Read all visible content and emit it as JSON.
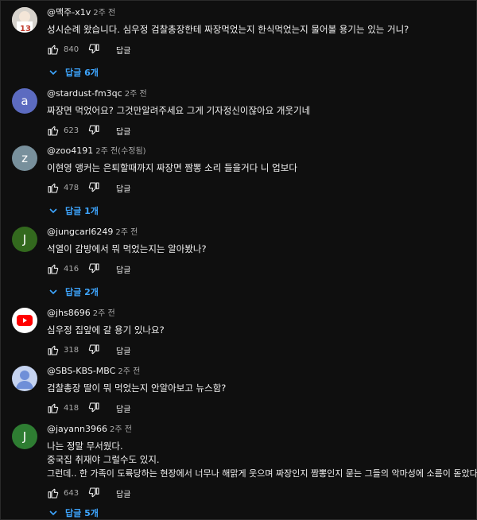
{
  "reply_label": "답글",
  "comments": [
    {
      "author": "@맥주-x1v",
      "time": "2주 전",
      "avatar": {
        "letter": "",
        "color": "#c8c8c8",
        "type": "image"
      },
      "lines": [
        "성시순례 왔습니다. 심우정 검찰총장한테 짜장먹었는지 한식먹었는지 물어볼 용기는 있는 거니?"
      ],
      "likes": "840",
      "replies": "답글 6개"
    },
    {
      "author": "@stardust-fm3qc",
      "time": "2주 전",
      "avatar": {
        "letter": "a",
        "color": "#5c6bc0",
        "type": "letter"
      },
      "lines": [
        "짜장면 먹었어요? 그것만알려주세요 그게 기자정신이잖아요 개웃기네"
      ],
      "likes": "623",
      "replies": ""
    },
    {
      "author": "@zoo4191",
      "time": "2주 전(수정됨)",
      "avatar": {
        "letter": "z",
        "color": "#78909c",
        "type": "letter"
      },
      "lines": [
        "이현영 앵커는 은퇴할때까지 짜장면 짬뽕 소리 들을거다 니 업보다"
      ],
      "likes": "478",
      "replies": "답글 1개"
    },
    {
      "author": "@jungcarl6249",
      "time": "2주 전",
      "avatar": {
        "letter": "J",
        "color": "#33691e",
        "type": "letter"
      },
      "lines": [
        "석열이 감방에서 뭐 먹었는지는 알아봤나?"
      ],
      "likes": "416",
      "replies": "답글 2개"
    },
    {
      "author": "@jhs8696",
      "time": "2주 전",
      "avatar": {
        "letter": "",
        "color": "#ffffff",
        "type": "youtube"
      },
      "lines": [
        "심우정 집앞에 갈 용기 있나요?"
      ],
      "likes": "318",
      "replies": ""
    },
    {
      "author": "@SBS-KBS-MBC",
      "time": "2주 전",
      "avatar": {
        "letter": "",
        "color": "#c5d3f0",
        "type": "person"
      },
      "lines": [
        "검찰총장 딸이 뭐 먹었는지 안알아보고 뉴스함?"
      ],
      "likes": "418",
      "replies": ""
    },
    {
      "author": "@jayann3966",
      "time": "2주 전",
      "avatar": {
        "letter": "J",
        "color": "#2e7d32",
        "type": "letter"
      },
      "lines": [
        "나는 정말 무서웠다.",
        "중국집 취재야 그럴수도 있지.",
        "그런데.. 한 가족이 도륙당하는 현장에서 너무나 해맑게 웃으며 짜장인지 짬뽕인지 묻는 그들의 악마성에 소름이 돋았다."
      ],
      "likes": "643",
      "replies": "답글 5개"
    }
  ]
}
